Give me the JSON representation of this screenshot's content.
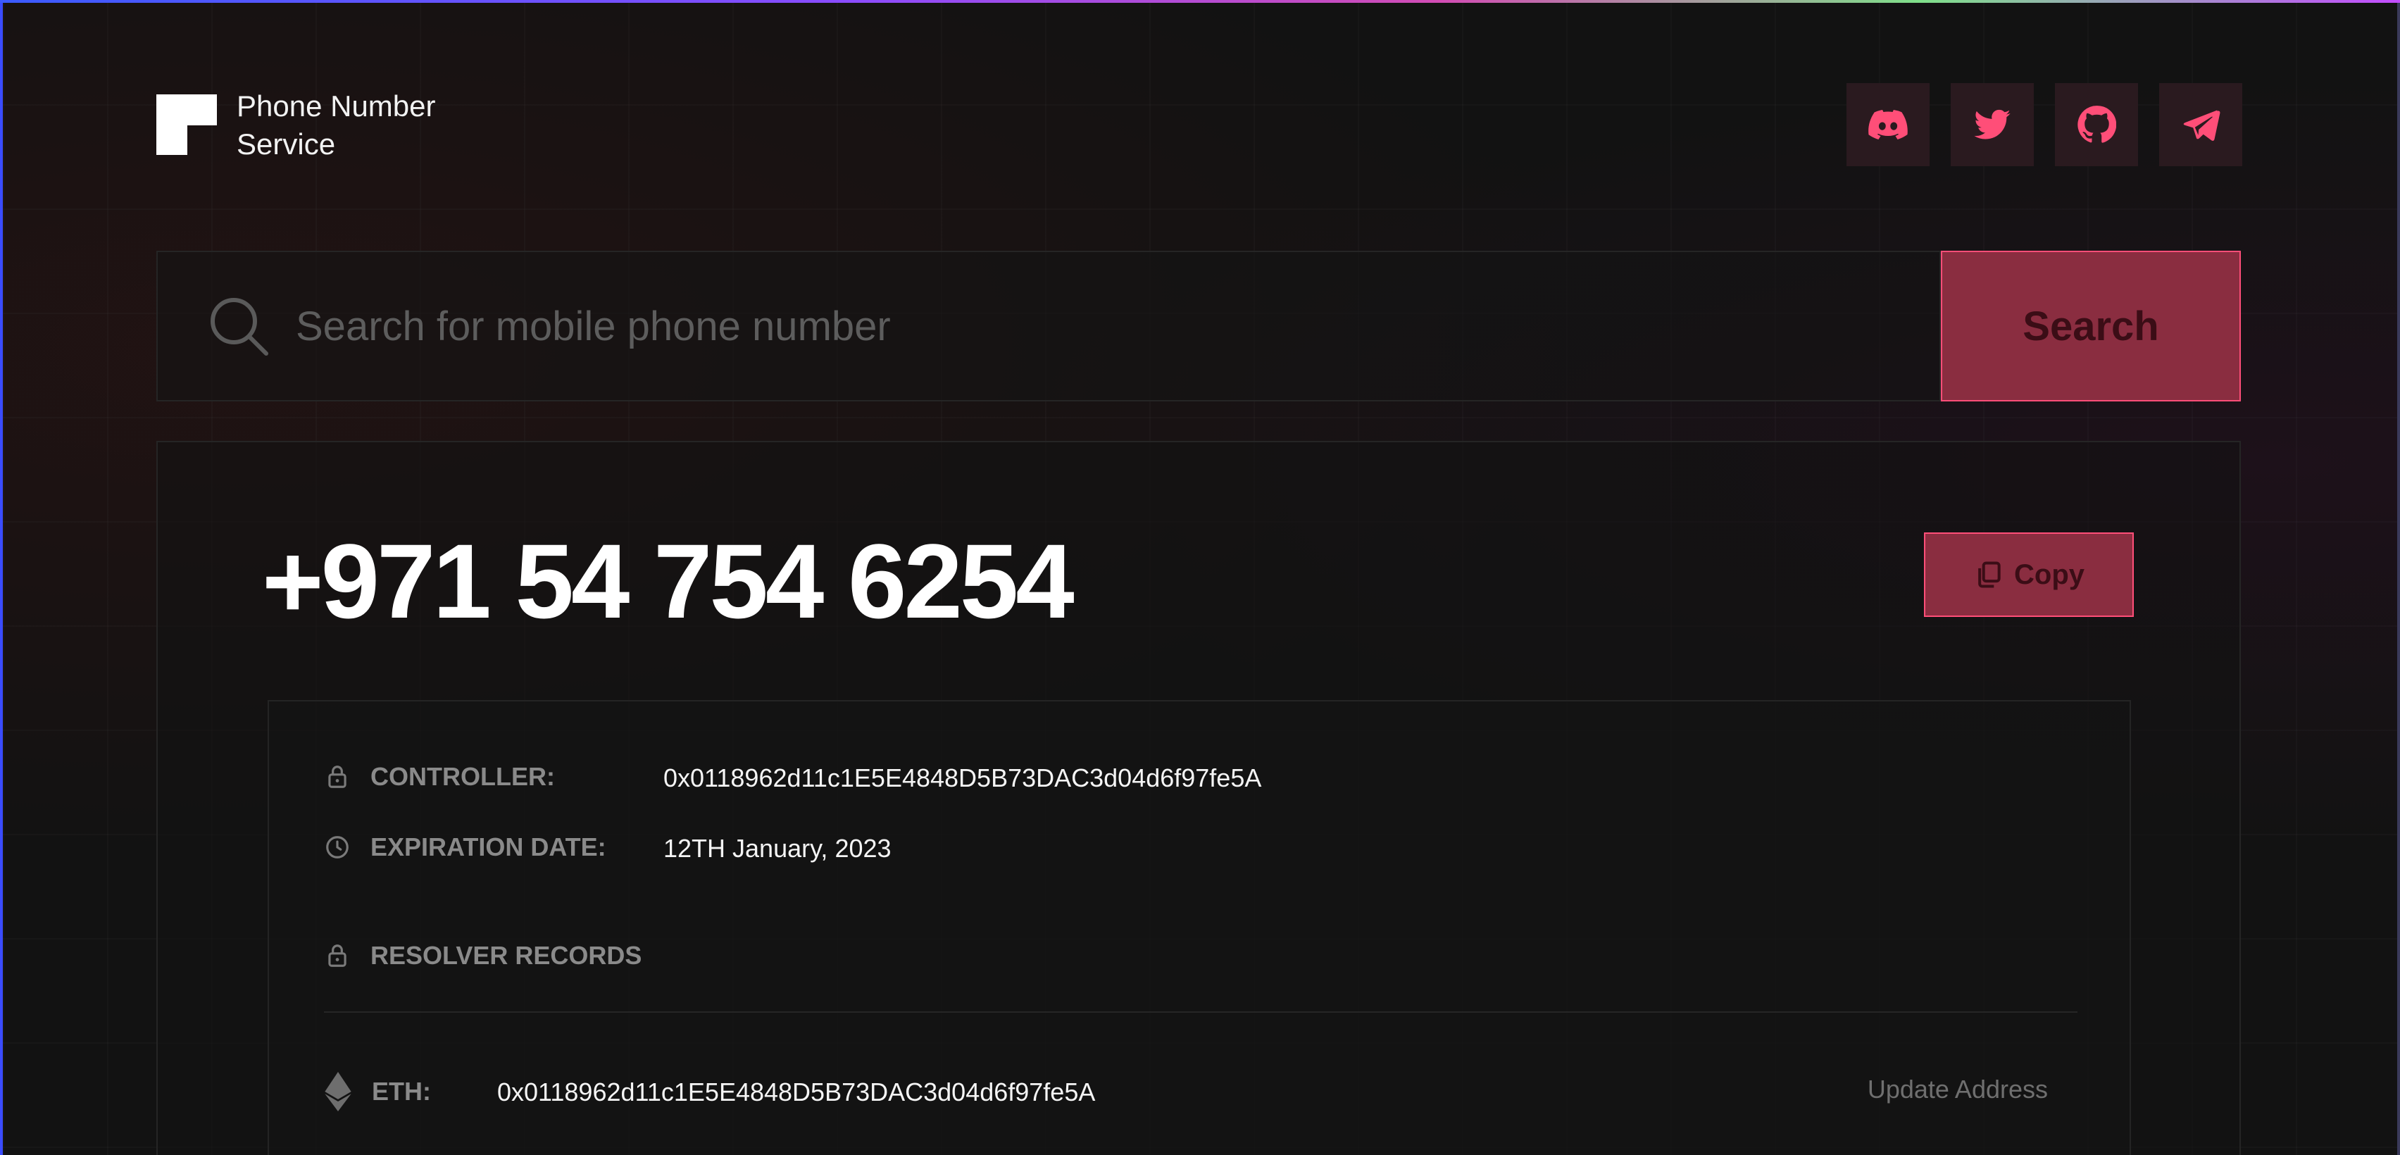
{
  "header": {
    "brand_line1": "Phone Number",
    "brand_line2": "Service",
    "social": [
      "discord-icon",
      "twitter-icon",
      "github-icon",
      "telegram-icon"
    ]
  },
  "search": {
    "placeholder": "Search for mobile phone number",
    "button_label": "Search"
  },
  "record": {
    "phone": "+971 54 754 6254",
    "copy_label": "Copy",
    "controller_label": "CONTROLLER:",
    "controller_value": "0x0118962d11c1E5E4848D5B73DAC3d04d6f97fe5A",
    "expiration_label": "EXPIRATION DATE:",
    "expiration_value": "12TH January, 2023",
    "resolver_label": "RESOLVER RECORDS",
    "eth_label": "ETH:",
    "eth_value": "0x0118962d11c1E5E4848D5B73DAC3d04d6f97fe5A",
    "update_label": "Update Address"
  },
  "colors": {
    "accent": "#ff4e78",
    "button_fill": "#8a2d40",
    "background": "#121212"
  }
}
